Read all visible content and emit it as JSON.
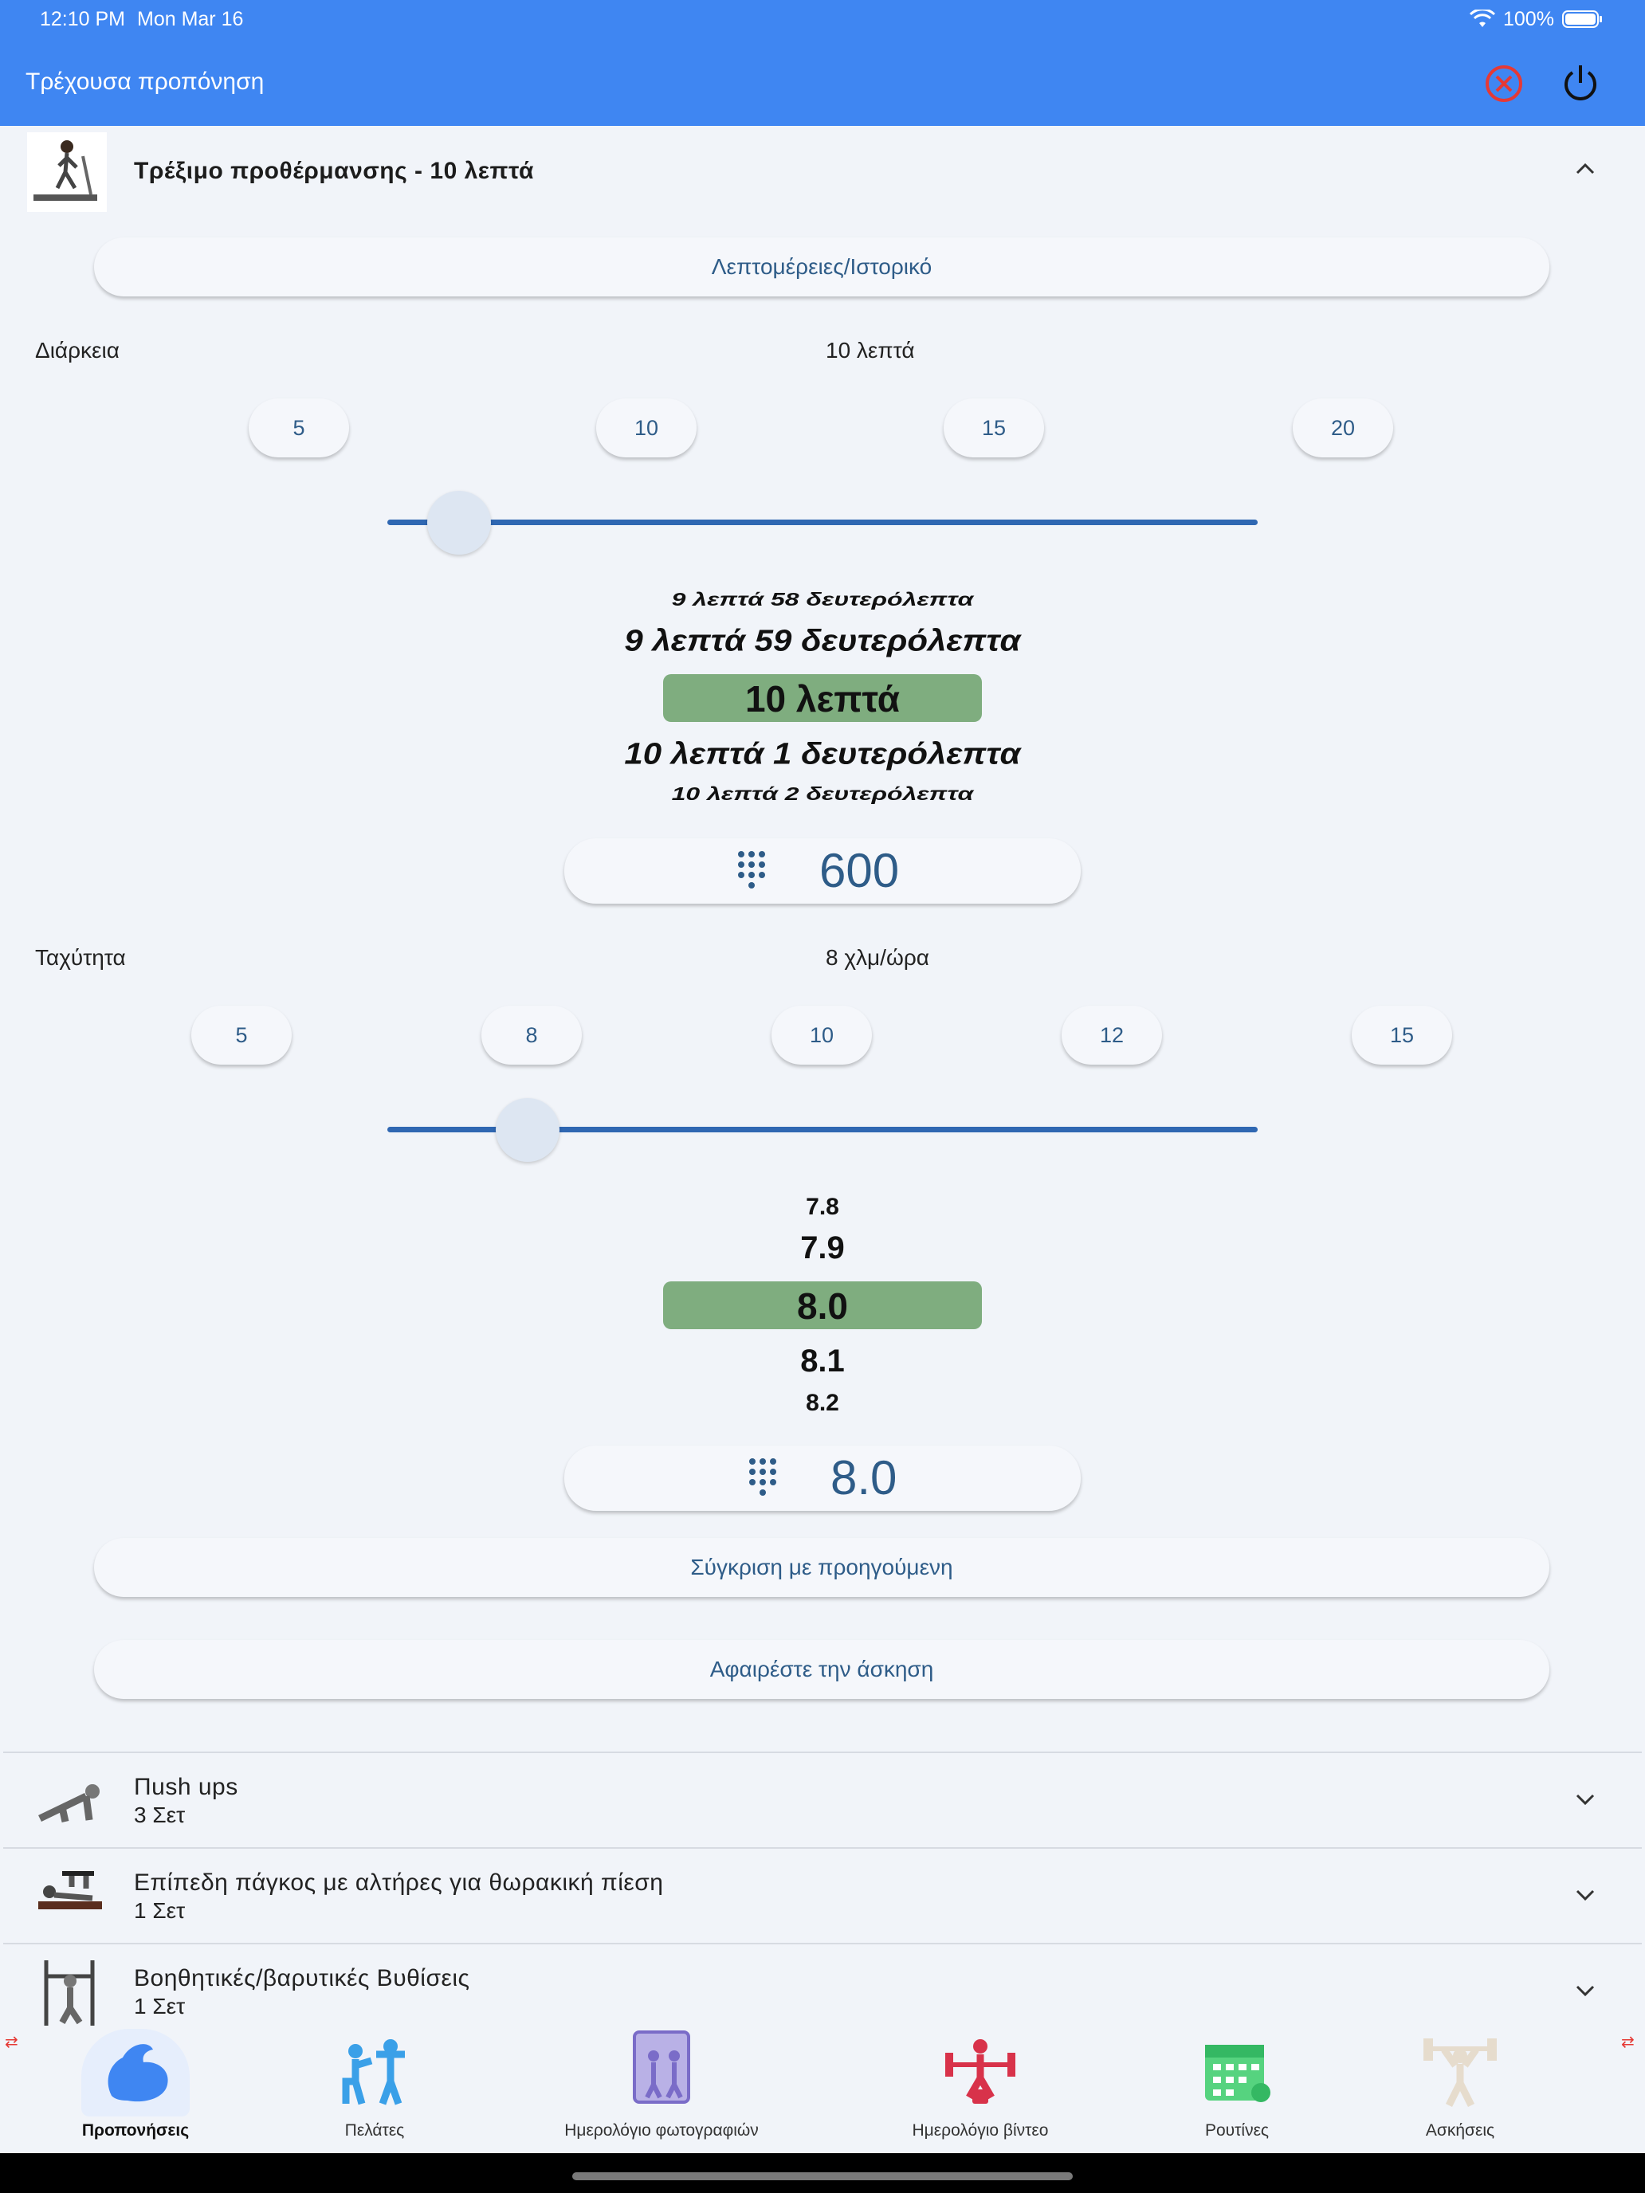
{
  "status_bar": {
    "time": "12:10 PM",
    "date": "Mon Mar 16",
    "battery": "100%"
  },
  "app_bar": {
    "title": "Τρέχουσα προπόνηση",
    "cancel_icon": "cancel-circle-icon",
    "power_icon": "power-icon"
  },
  "current_exercise": {
    "title": "Τρέξιμο προθέρμανσης - 10 λεπτά",
    "details_button": "Λεπτομέρειες/Ιστορικό",
    "duration": {
      "label": "Διάρκεια",
      "value_text": "10 λεπτά",
      "chips": [
        "5",
        "10",
        "15",
        "20"
      ],
      "slider_value": 10,
      "slider_min": 5,
      "slider_max": 20,
      "wheel": [
        "9 λεπτά 58 δευτερόλεπτα",
        "9 λεπτά 59 δευτερόλεπτα",
        "10 λεπτά",
        "10 λεπτά 1 δευτερόλεπτα",
        "10 λεπτά 2 δευτερόλεπτα"
      ],
      "numeric": "600"
    },
    "speed": {
      "label": "Ταχύτητα",
      "value_text": "8 χλμ/ώρα",
      "chips": [
        "5",
        "8",
        "10",
        "12",
        "15"
      ],
      "slider_value": 8,
      "slider_min": 5,
      "slider_max": 30,
      "wheel": [
        "7.8",
        "7.9",
        "8.0",
        "8.1",
        "8.2"
      ],
      "numeric": "8.0"
    },
    "compare_button": "Σύγκριση με προηγούμενη",
    "remove_button": "Αφαιρέστε την άσκηση"
  },
  "exercises": [
    {
      "title": "Πush ups",
      "sets": "3 Σετ"
    },
    {
      "title": "Επίπεδη πάγκος με αλτήρες για θωρακική πίεση",
      "sets": "1 Σετ"
    },
    {
      "title": "Βοηθητικές/βαρυτικές Βυθίσεις",
      "sets": "1 Σετ"
    }
  ],
  "bottom_nav": [
    {
      "label": "Προπονήσεις",
      "icon": "muscle-arm-icon",
      "active": true
    },
    {
      "label": "Πελάτες",
      "icon": "trainer-clients-icon"
    },
    {
      "label": "Ημερολόγιο φωτογραφιών",
      "icon": "photo-diary-icon"
    },
    {
      "label": "Ημερολόγιο βίντεο",
      "icon": "weightlifting-video-icon"
    },
    {
      "label": "Ρουτίνες",
      "icon": "calendar-routine-icon"
    },
    {
      "label": "Ασκήσεις",
      "icon": "barbell-exercise-icon"
    }
  ],
  "colors": {
    "app_bar": "#3f86f2",
    "accent": "#2f67b2",
    "selected_band": "#7fad7f",
    "cancel": "#e53935"
  }
}
